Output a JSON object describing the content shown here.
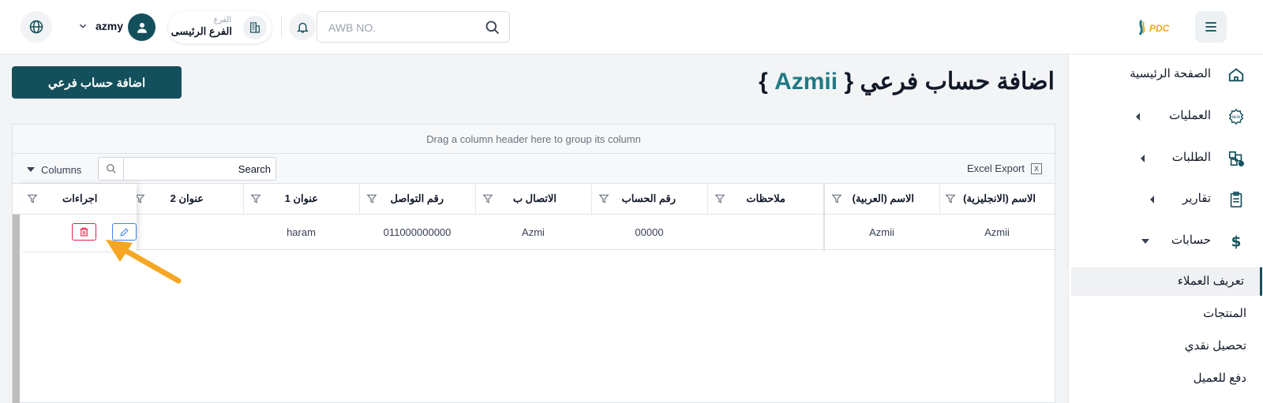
{
  "header": {
    "search_placeholder": "AWB NO.",
    "branch_label_small": "الفرع",
    "branch_name": "الفرع الرئيسى",
    "user_name": "azmy",
    "logo_text": "PDC"
  },
  "sidebar": {
    "items": [
      {
        "label": "الصفحة الرئيسية",
        "icon": "home-icon"
      },
      {
        "label": "العمليات",
        "icon": "new-badge-icon"
      },
      {
        "label": "الطلبات",
        "icon": "boxes-icon"
      },
      {
        "label": "تقارير",
        "icon": "clipboard-icon"
      },
      {
        "label": "حسابات",
        "icon": "dollar-icon"
      }
    ],
    "sub_items": [
      {
        "label": "تعريف العملاء",
        "active": true
      },
      {
        "label": "المنتجات"
      },
      {
        "label": "تحصيل نقدي"
      },
      {
        "label": "دفع للعميل"
      }
    ]
  },
  "page": {
    "title_prefix": "اضافة حساب فرعي { ",
    "title_account": "Azmii",
    "title_suffix": " }",
    "add_button": "اضافة حساب فرعي"
  },
  "grid": {
    "group_hint": "Drag a column header here to group its column",
    "columns_label": "Columns",
    "search_placeholder": "Search",
    "excel_export": "Excel Export",
    "headers": {
      "name_en": "الاسم (الانجليزية)",
      "name_ar": "الاسم (العربية)",
      "notes": "ملاحظات",
      "account_no": "رقم الحساب",
      "contact": "الاتصال ب",
      "phone": "رقم التواصل",
      "address1": "عنوان 1",
      "address2": "عنوان 2",
      "actions": "اجراءات"
    },
    "rows": [
      {
        "name_en": "Azmii",
        "name_ar": "Azmii",
        "notes": "",
        "account_no": "00000",
        "contact": "Azmi",
        "phone": "011000000000",
        "address1": "haram",
        "address2": ""
      }
    ]
  },
  "colors": {
    "primary": "#14505c",
    "accent": "#1f7a84",
    "edit": "#3b82f6",
    "delete": "#e11d48",
    "arrow": "#f5a623"
  }
}
